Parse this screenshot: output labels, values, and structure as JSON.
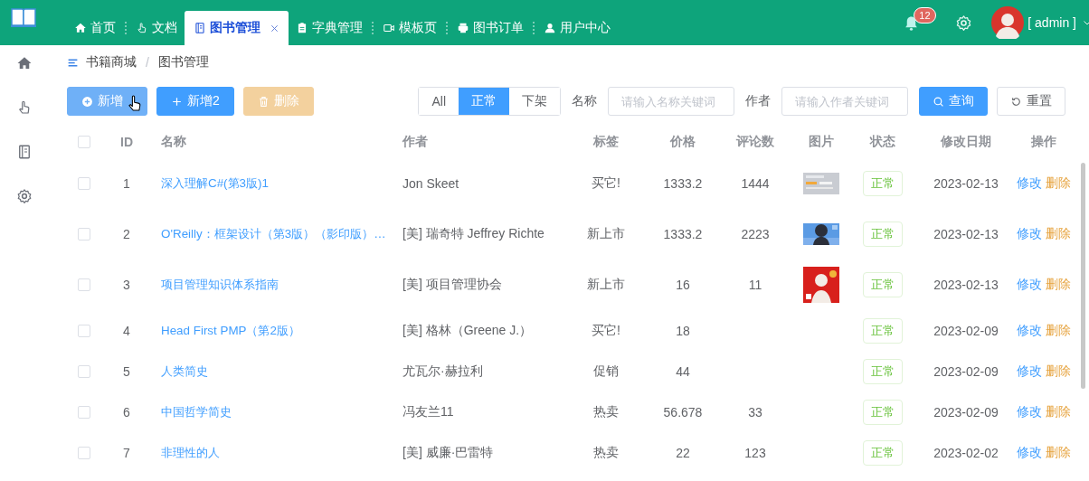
{
  "header": {
    "tabs": [
      {
        "label": "首页",
        "selected": false,
        "closable": false
      },
      {
        "label": "文档",
        "selected": false,
        "closable": false
      },
      {
        "label": "图书管理",
        "selected": true,
        "closable": true
      },
      {
        "label": "字典管理",
        "selected": false,
        "closable": false
      },
      {
        "label": "模板页",
        "selected": false,
        "closable": false
      },
      {
        "label": "图书订单",
        "selected": false,
        "closable": false
      },
      {
        "label": "用户中心",
        "selected": false,
        "closable": false
      }
    ],
    "notification_count": "12",
    "user": "[ admin ]"
  },
  "breadcrumb": {
    "items": [
      "书籍商城",
      "图书管理"
    ],
    "separator": "/"
  },
  "toolbar": {
    "buttons": [
      {
        "label": "新增",
        "kind": "primary",
        "disabled": false,
        "hovered": true
      },
      {
        "label": "新增2",
        "kind": "primary",
        "disabled": false,
        "hovered": false
      },
      {
        "label": "删除",
        "kind": "warning",
        "disabled": true,
        "hovered": false
      }
    ],
    "filter": [
      {
        "label": "All",
        "selected": false
      },
      {
        "label": "正常",
        "selected": true
      },
      {
        "label": "下架",
        "selected": false
      }
    ],
    "fields": [
      {
        "label": "名称",
        "placeholder": "请输入名称关键词"
      },
      {
        "label": "作者",
        "placeholder": "请输入作者关键词"
      }
    ],
    "search_button": "查询",
    "reset_button": "重置"
  },
  "table": {
    "all_checked": false,
    "columns": [
      "ID",
      "名称",
      "作者",
      "标签",
      "价格",
      "评论数",
      "图片",
      "状态",
      "修改日期",
      "操作"
    ],
    "rows": [
      {
        "checked": false,
        "id": "1",
        "name": "深入理解C#(第3版)1",
        "author": "Jon Skeet",
        "tag": "买它!",
        "price": "1333.2",
        "comments": "1444",
        "picture": {
          "kind": "picture"
        },
        "status": "正常",
        "date": "2023-02-13",
        "actions": [
          "修改",
          "删除"
        ]
      },
      {
        "checked": false,
        "id": "2",
        "name": "O'Reilly：框架设计（第3版）（影印版）…",
        "author": "[美] 瑞奇特 Jeffrey Richte",
        "tag": "新上市",
        "price": "1333.2",
        "comments": "2223",
        "picture": {
          "kind": "picture"
        },
        "status": "正常",
        "date": "2023-02-13",
        "actions": [
          "修改",
          "删除"
        ]
      },
      {
        "checked": false,
        "id": "3",
        "name": "项目管理知识体系指南",
        "author": "[美] 项目管理协会",
        "tag": "新上市",
        "price": "16",
        "comments": "11",
        "picture": {
          "kind": "picture"
        },
        "status": "正常",
        "date": "2023-02-13",
        "actions": [
          "修改",
          "删除"
        ]
      },
      {
        "checked": false,
        "id": "4",
        "name": "Head First PMP（第2版）",
        "author": "[美] 格林（Greene J.）",
        "tag": "买它!",
        "price": "18",
        "status": "正常",
        "date": "2023-02-09",
        "actions": [
          "修改",
          "删除"
        ]
      },
      {
        "checked": false,
        "id": "5",
        "name": "人类简史",
        "author": "尤瓦尔·赫拉利",
        "tag": "促销",
        "price": "44",
        "status": "正常",
        "date": "2023-02-09",
        "actions": [
          "修改",
          "删除"
        ]
      },
      {
        "checked": false,
        "id": "6",
        "name": "中国哲学简史",
        "author": "冯友兰11",
        "tag": "热卖",
        "price": "56.678",
        "comments": "33",
        "status": "正常",
        "date": "2023-02-09",
        "actions": [
          "修改",
          "删除"
        ]
      },
      {
        "checked": false,
        "id": "7",
        "name": "非理性的人",
        "author": "[美] 威廉·巴雷特",
        "tag": "热卖",
        "price": "22",
        "comments": "123",
        "status": "正常",
        "date": "2023-02-02",
        "actions": [
          "修改",
          "删除"
        ]
      }
    ]
  }
}
